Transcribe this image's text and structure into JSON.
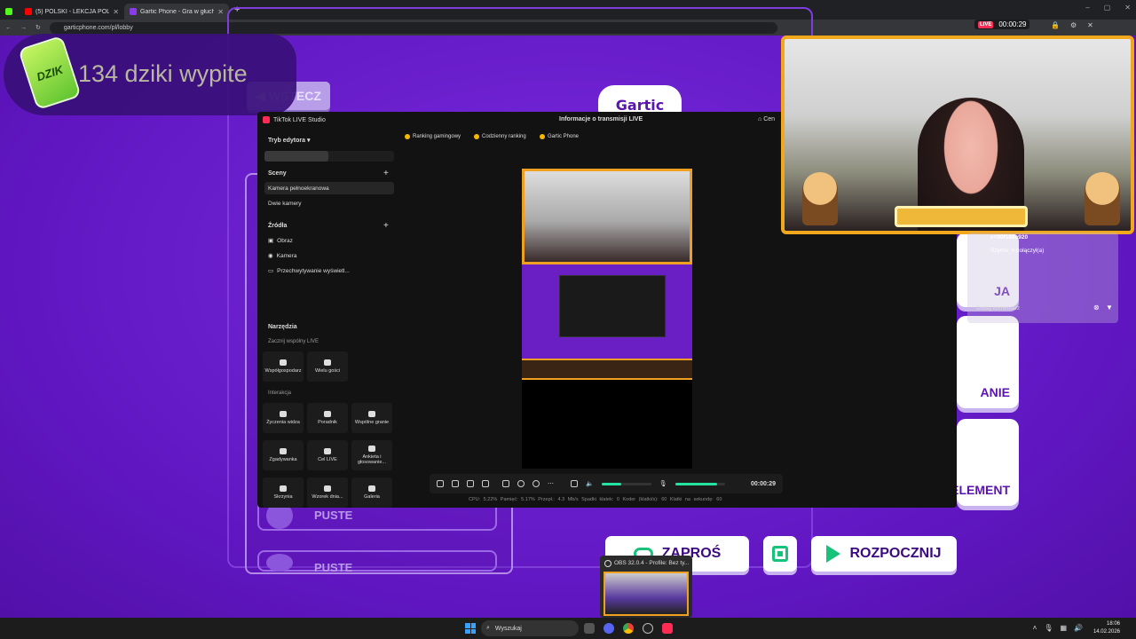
{
  "browser": {
    "tabs": [
      {
        "title": "(5) POLSKI - LEKCJA POLSKIEGO",
        "color": "#ff0000"
      },
      {
        "title": "Gartic Phone - Gra w głuchy telefon",
        "color": "#8a3ce6"
      }
    ],
    "url": "garticphone.com/pl/lobby"
  },
  "overlay": {
    "can_label": "DZIK",
    "counter_text": "134 dziki wypite"
  },
  "game": {
    "logo_text": "Gartic",
    "back_label": "WSTECZ",
    "empty_slot_label": "PUSTE",
    "tile_labels": [
      "JA",
      "ANIE",
      "ELEMENT"
    ],
    "invite_label": "ZAPROŚ",
    "start_label": "ROZPOCZNIJ"
  },
  "tiktok": {
    "window_title": "TikTok LIVE Studio",
    "center_title": "Informacje o transmisji LIVE",
    "home_label": "Cen",
    "editor_mode": "Tryb edytora",
    "scenes_label": "Sceny",
    "scenes": [
      "Kamera pełnoekranowa",
      "Dwie kamery"
    ],
    "sources_label": "Źródła",
    "sources": [
      "Obraz",
      "Kamera",
      "Przechwytywanie wyświetl..."
    ],
    "tools_label": "Narzędzia",
    "start_live_label": "Zacznij wspólny LIVE",
    "cohost_tools": [
      "Współgospodarz",
      "Wielu gości"
    ],
    "interaction_label": "Interakcja",
    "interaction_tools": [
      "Życzenia widza",
      "Poradnik",
      "Wspólne granie",
      "Zgadywanka",
      "Cel LIVE",
      "Ankieta i głosowanie...",
      "Skrzynia",
      "Wzorek dnia...",
      "Galeria"
    ],
    "chips": [
      "Ranking gamingowy",
      "Codzienny ranking",
      "Gartic Phone"
    ],
    "timer": "00:00:29",
    "stats": "CPU: 5.22%   Pamięć: 5.17%   Przepł.: 4.3 Mb/s   Spadki klatek: 0   Koder (klatki/s): 60   Klatki na sekundę: 60",
    "mic_level": 0.85,
    "speaker_level": 0.4
  },
  "recording": {
    "badge": "LIVE",
    "time": "00:00:29"
  },
  "chat": {
    "username": "c=00f198c920",
    "join_message": "Szymo_n dołączył(a)",
    "input_placeholder": "Dodaj komentarz"
  },
  "obs": {
    "title": "OBS 32.0.4 - Profile: Bez ty..."
  },
  "taskbar": {
    "search_label": "Wyszukaj",
    "time": "18:06",
    "date": "14.02.2026"
  }
}
